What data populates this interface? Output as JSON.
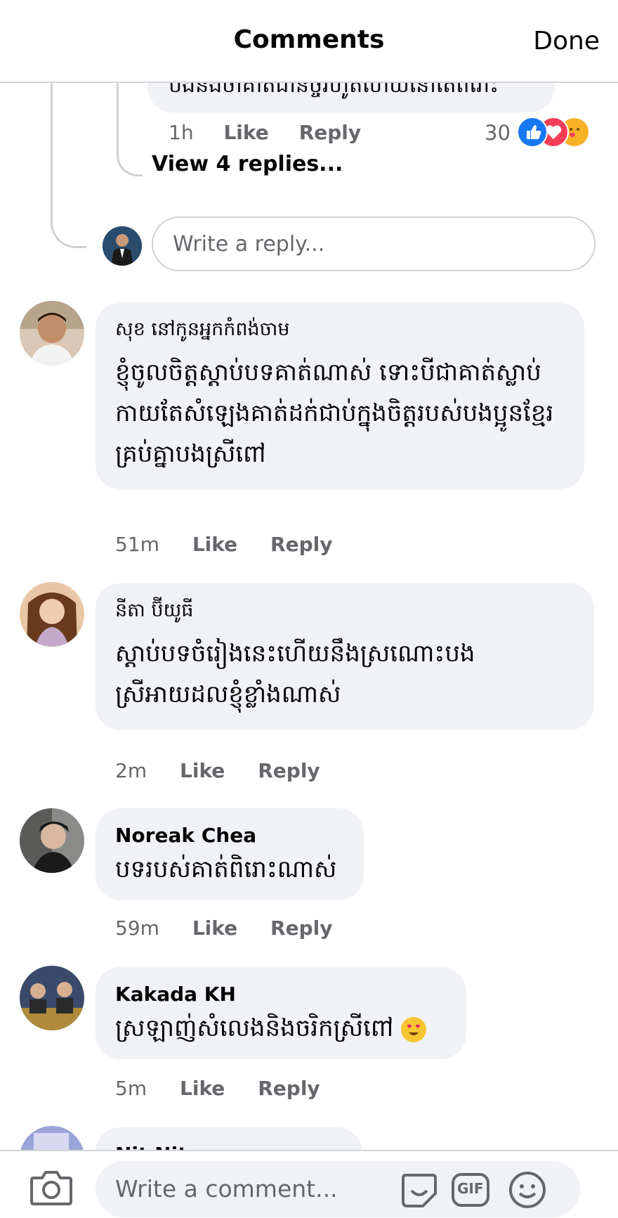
{
  "header": {
    "title": "Comments",
    "done_label": "Done"
  },
  "top_reply": {
    "partial_text": "បងនិងចាំគាត់ជានិច្ចរហូតហើយនៅតែពីរោះ",
    "time": "1h",
    "like_label": "Like",
    "reply_label": "Reply",
    "reaction_count": "30",
    "reactions": [
      "like",
      "love",
      "care"
    ]
  },
  "view_replies_label": "View 4 replies...",
  "reply_input": {
    "placeholder": "Write a reply..."
  },
  "comments": [
    {
      "author": "សុខ នៅកូនអ្នកកំពង់ចាម",
      "text": "ខ្ញុំចូលចិត្តស្តាប់បទគាត់ណាស់ ទោះបីជាគាត់ស្លាប់កាយតែសំឡេងគាត់ដក់ជាប់ក្នុងចិត្តរបស់បងប្អូនខ្មែរគ្រប់គ្នាបងស្រីពៅ",
      "time": "51m",
      "like_label": "Like",
      "reply_label": "Reply"
    },
    {
      "author": "នីតា ប៊ីយូធី",
      "text": "ស្តាប់បទចំរៀងនេះហើយនឹងស្រណោះបងស្រីអាយដលខ្ញុំខ្លាំងណាស់",
      "time": "2m",
      "like_label": "Like",
      "reply_label": "Reply"
    },
    {
      "author": "Noreak Chea",
      "text": "បទរបស់គាត់ពិរោះណាស់",
      "time": "59m",
      "like_label": "Like",
      "reply_label": "Reply"
    },
    {
      "author": "Kakada KH",
      "text": "ស្រឡាញ់សំលេងនិងចរិកស្រីពៅ",
      "time": "5m",
      "like_label": "Like",
      "reply_label": "Reply"
    },
    {
      "author": "Nit Nit"
    }
  ],
  "footer": {
    "placeholder": "Write a comment...",
    "gif_label": "GIF",
    "icons": [
      "camera-icon",
      "sticker-icon",
      "gif-icon",
      "emoji-icon"
    ]
  },
  "colors": {
    "meta_gray": "#65676b",
    "bubble_bg": "#f0f2f5",
    "like_blue": "#1877f2",
    "love_red": "#f33e58",
    "care_yellow": "#f7b125"
  }
}
